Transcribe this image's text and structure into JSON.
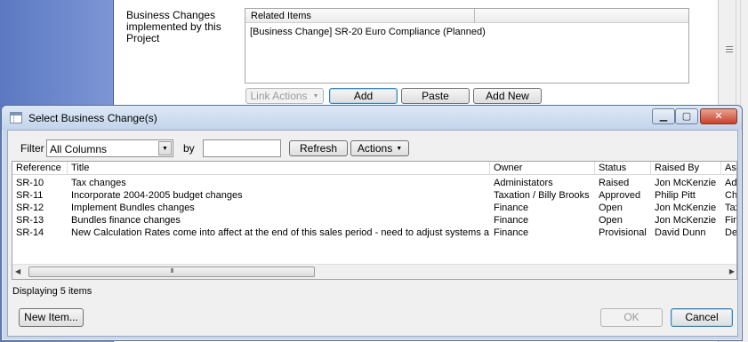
{
  "background": {
    "business_changes_label": "Business Changes implemented by this Project",
    "related_header": "Related Items",
    "related_item": "[Business Change] SR-20 Euro Compliance (Planned)",
    "buttons": {
      "link_actions": "Link Actions",
      "add": "Add",
      "paste": "Paste",
      "add_new": "Add New"
    }
  },
  "dialog": {
    "title": "Select Business Change(s)",
    "window_buttons": {
      "minimize": "▁",
      "maximize": "▢",
      "close": "✕"
    },
    "filter": {
      "label": "Filter",
      "selected": "All Columns",
      "by_label": "by",
      "by_value": "",
      "refresh": "Refresh",
      "actions": "Actions"
    },
    "columns": [
      "Reference",
      "Title",
      "Owner",
      "Status",
      "Raised By",
      "Assi"
    ],
    "rows": [
      [
        "SR-10",
        "Tax changes",
        "Administators",
        "Raised",
        "Jon McKenzie",
        "Adm"
      ],
      [
        "SR-11",
        "Incorporate 2004-2005 budget changes",
        "Taxation / Billy Brooks",
        "Approved",
        "Philip Pitt",
        "Char"
      ],
      [
        "SR-12",
        "Implement Bundles changes",
        "Finance",
        "Open",
        "Jon McKenzie",
        "Taxa"
      ],
      [
        "SR-13",
        "Bundles finance changes",
        "Finance",
        "Open",
        "Jon McKenzie",
        "Fina"
      ],
      [
        "SR-14",
        "New Calculation Rates come into affect at the end of this sales period - need to adjust systems a...",
        "Finance",
        "Provisional",
        "David Dunn",
        "Dev"
      ]
    ],
    "status_text": "Displaying 5 items",
    "scroll_thumb_grip": "III",
    "new_item": "New Item...",
    "ok": "OK",
    "cancel": "Cancel"
  },
  "colors": {
    "desktop_blue": "#6a86c9",
    "title_bar": "#c9d7ea",
    "close_red": "#c7432c"
  }
}
